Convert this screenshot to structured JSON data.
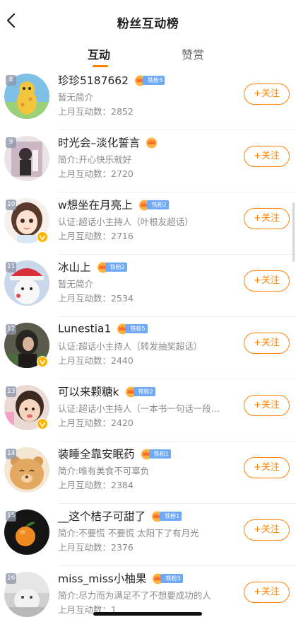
{
  "header": {
    "title": "粉丝互动榜",
    "back_icon": "chevron-left-icon"
  },
  "tabs": [
    {
      "label": "互动",
      "active": true
    },
    {
      "label": "赞赏",
      "active": false
    }
  ],
  "colors": {
    "accent": "#ff8200",
    "fan_badge": "#6fa8f5"
  },
  "follow_label": "+关注",
  "rows": [
    {
      "rank": "8",
      "name": "珍珍5187662",
      "fan_badge": "铁粉3",
      "desc": "暂无简介",
      "count": "上月互动数：2852",
      "verified": false
    },
    {
      "rank": "9",
      "name": "时光会–淡化誓言",
      "fan_badge": "",
      "desc": "简介:开心快乐就好",
      "count": "上月互动数：2720",
      "verified": false
    },
    {
      "rank": "10",
      "name": "w想坐在月亮上",
      "fan_badge": "铁粉2",
      "desc": "认证:超话小主持人（叶根友超话）",
      "count": "上月互动数：2716",
      "verified": true
    },
    {
      "rank": "11",
      "name": "冰山上",
      "fan_badge": "铁粉2",
      "desc": "暂无简介",
      "count": "上月互动数：2534",
      "verified": false
    },
    {
      "rank": "12",
      "name": "Lunestia1",
      "fan_badge": "铁粉5",
      "desc": "认证:超话小主持人（转发抽奖超话）",
      "count": "上月互动数：2440",
      "verified": true
    },
    {
      "rank": "13",
      "name": "可以来颗糖k",
      "fan_badge": "铁粉2",
      "desc": "认证:超话小主持人（一本书一句话一段…",
      "count": "上月互动数：2420",
      "verified": true
    },
    {
      "rank": "14",
      "name": "装睡全靠安眠药",
      "fan_badge": "铁粉1",
      "desc": "简介:唯有美食不可辜负",
      "count": "上月互动数：2384",
      "verified": false
    },
    {
      "rank": "15",
      "name": "__这个桔子可甜了",
      "fan_badge": "铁粉1",
      "desc": "简介:不要慌 不要慌 太阳下了有月光",
      "count": "上月互动数：2376",
      "verified": false
    },
    {
      "rank": "16",
      "name": "miss_miss小柚果",
      "fan_badge": "铁粉3",
      "desc": "简介:尽力而为满足不了不想要成功的人",
      "count": "上月互动数：1",
      "verified": false
    }
  ]
}
